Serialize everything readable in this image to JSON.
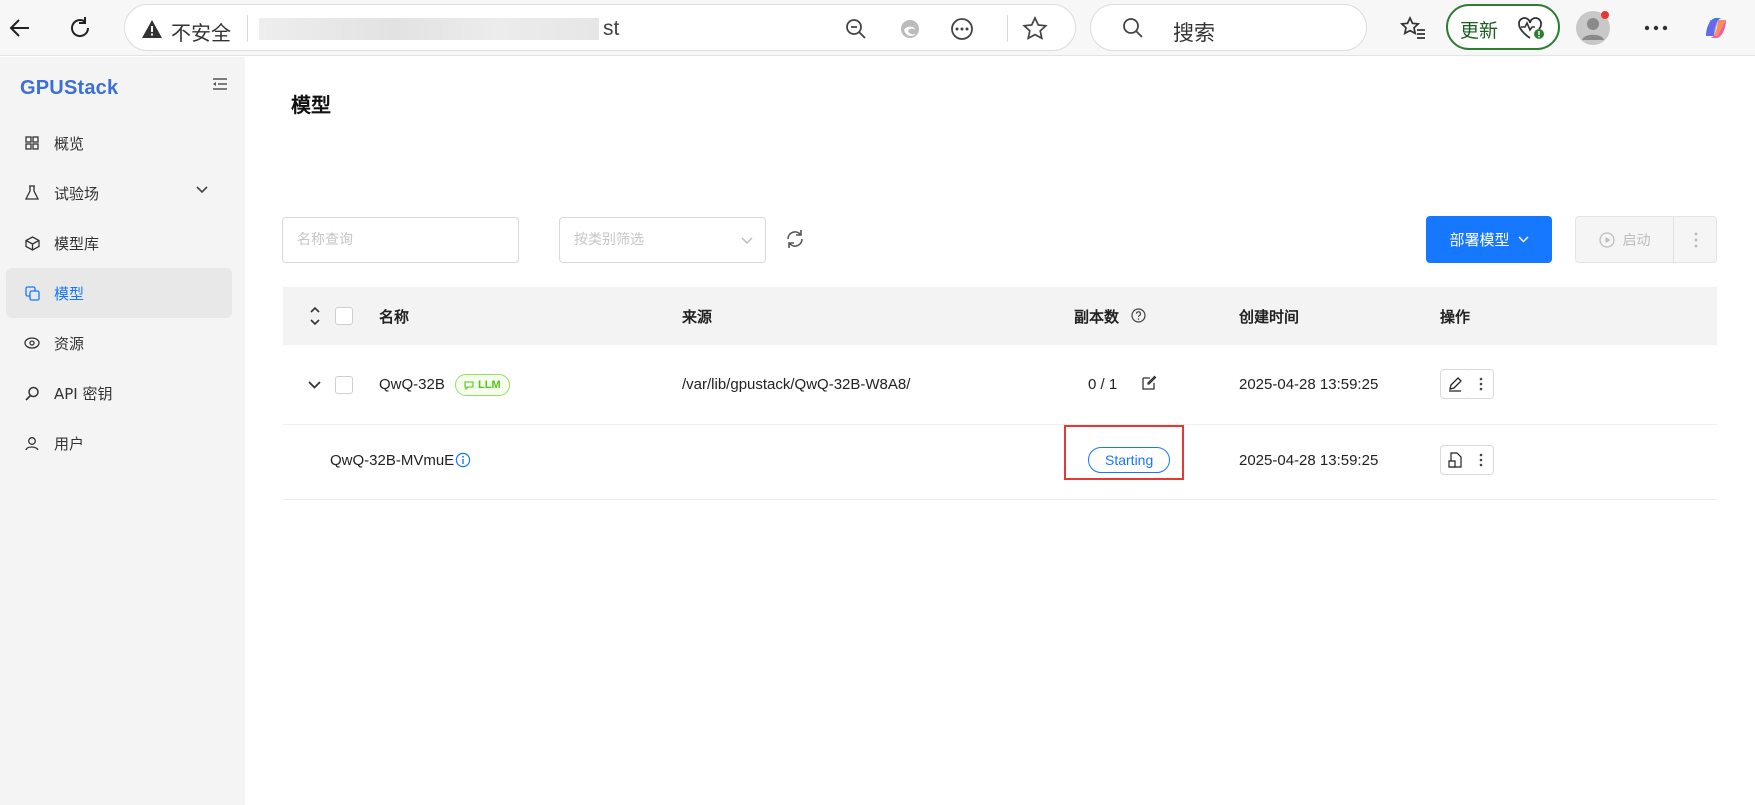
{
  "browser": {
    "insecure_label": "不安全",
    "url_visible": "st",
    "search_placeholder": "搜索",
    "update_label": "更新"
  },
  "app": {
    "logo": "GPUStack",
    "menu": [
      {
        "label": "概览",
        "icon": "grid-icon"
      },
      {
        "label": "试验场",
        "icon": "flask-icon",
        "has_children": true
      },
      {
        "label": "模型库",
        "icon": "cube-icon"
      },
      {
        "label": "模型",
        "icon": "models-icon",
        "active": true
      },
      {
        "label": "资源",
        "icon": "resources-icon"
      },
      {
        "label": "API 密钥",
        "icon": "key-icon"
      },
      {
        "label": "用户",
        "icon": "user-icon"
      }
    ]
  },
  "page": {
    "title": "模型",
    "filter": {
      "name_placeholder": "名称查询",
      "category_placeholder": "按类别筛选"
    },
    "deploy_label": "部署模型",
    "start_label": "启动"
  },
  "table": {
    "columns": {
      "name": "名称",
      "source": "来源",
      "replicas": "副本数",
      "created": "创建时间",
      "actions": "操作"
    },
    "rows": [
      {
        "name": "QwQ-32B",
        "tag": "LLM",
        "source": "/var/lib/gpustack/QwQ-32B-W8A8/",
        "replicas": "0 / 1",
        "created": "2025-04-28 13:59:25"
      },
      {
        "name": "QwQ-32B-MVmuE",
        "status": "Starting",
        "created": "2025-04-28 13:59:25"
      }
    ]
  },
  "colors": {
    "primary": "#1677ff",
    "tag_green": "#52c41a",
    "highlight_red": "#e53935",
    "update_green": "#2e7d32"
  }
}
